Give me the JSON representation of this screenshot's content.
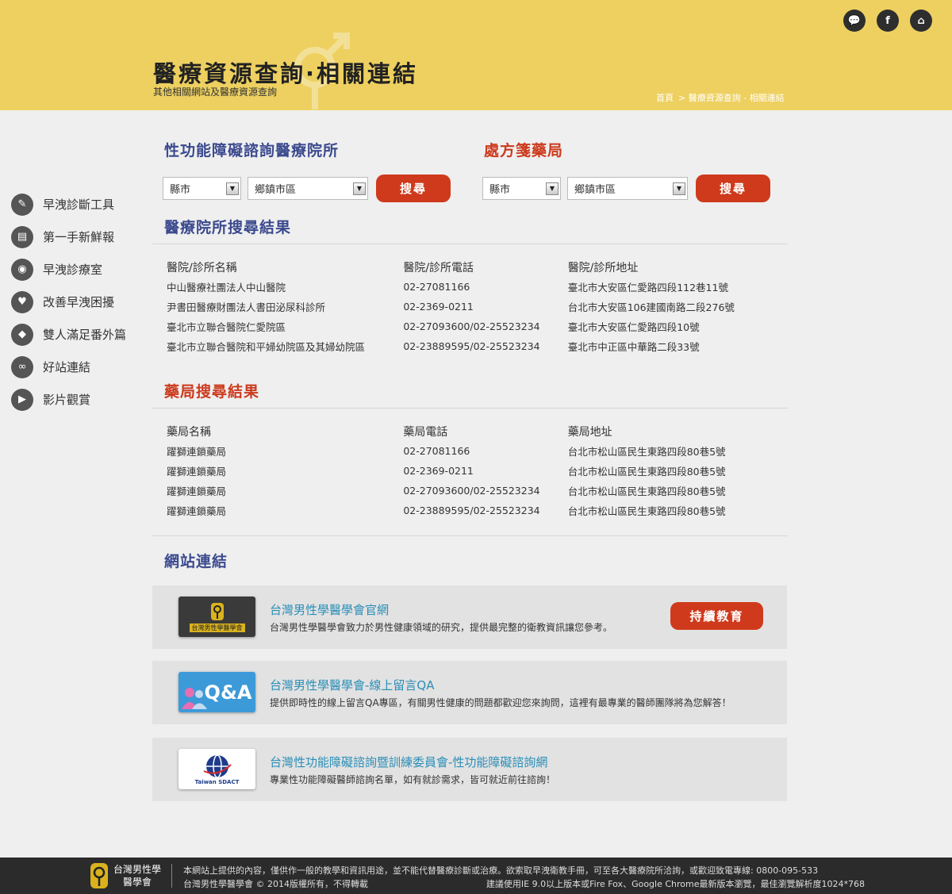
{
  "header": {
    "title": "醫療資源查詢·相關連結",
    "subtitle": "其他相關網站及醫療資源查詢",
    "breadcrumb": [
      "首頁",
      "> 醫療資源查詢 - 相關連結"
    ],
    "icons": [
      "chat-icon",
      "facebook-icon",
      "home-icon"
    ],
    "icon_glyphs": [
      "💬",
      "f",
      "⌂"
    ]
  },
  "sidebar": {
    "items": [
      {
        "label": "早洩診斷工具",
        "icon": "edit-icon",
        "glyph": "✎"
      },
      {
        "label": "第一手新鮮報",
        "icon": "news-icon",
        "glyph": "▤"
      },
      {
        "label": "早洩診療室",
        "icon": "camera-icon",
        "glyph": "◉"
      },
      {
        "label": "改善早洩困擾",
        "icon": "heart-icon",
        "glyph": "♥"
      },
      {
        "label": "雙人滿足番外篇",
        "icon": "diamond-icon",
        "glyph": "◆"
      },
      {
        "label": "好站連結",
        "icon": "link-icon",
        "glyph": "∞"
      },
      {
        "label": "影片觀賞",
        "icon": "video-icon",
        "glyph": "▶"
      }
    ]
  },
  "hospital_search": {
    "title": "性功能障礙諮詢醫療院所",
    "city_select": "縣市",
    "district_select": "鄉鎮市區",
    "button": "搜尋"
  },
  "pharmacy_search": {
    "title": "處方箋藥局",
    "city_select": "縣市",
    "district_select": "鄉鎮市區",
    "button": "搜尋"
  },
  "hospital_results": {
    "title": "醫療院所搜尋結果",
    "columns": [
      "醫院/診所名稱",
      "醫院/診所電話",
      "醫院/診所地址"
    ],
    "rows": [
      [
        "中山醫療社團法人中山醫院",
        "02-27081166",
        "臺北市大安區仁愛路四段112巷11號"
      ],
      [
        "尹書田醫療財團法人書田泌尿科診所",
        "02-2369-0211",
        "台北市大安區106建國南路二段276號"
      ],
      [
        "臺北市立聯合醫院仁愛院區",
        "02-27093600/02-25523234",
        "臺北市大安區仁愛路四段10號"
      ],
      [
        "臺北市立聯合醫院和平婦幼院區及其婦幼院區",
        "02-23889595/02-25523234",
        "臺北市中正區中華路二段33號"
      ]
    ]
  },
  "pharmacy_results": {
    "title": "藥局搜尋結果",
    "columns": [
      "藥局名稱",
      "藥局電話",
      "藥局地址"
    ],
    "rows": [
      [
        "躍獅連鎖藥局",
        "02-27081166",
        "台北市松山區民生東路四段80巷5號"
      ],
      [
        "躍獅連鎖藥局",
        "02-2369-0211",
        "台北市松山區民生東路四段80巷5號"
      ],
      [
        "躍獅連鎖藥局",
        "02-27093600/02-25523234",
        "台北市松山區民生東路四段80巷5號"
      ],
      [
        "躍獅連鎖藥局",
        "02-23889595/02-25523234",
        "台北市松山區民生東路四段80巷5號"
      ]
    ]
  },
  "web_links": {
    "title": "網站連結",
    "items": [
      {
        "title": "台灣男性學醫學會官網",
        "desc": "台灣男性學醫學會致力於男性健康領域的研究，提供最完整的衛教資訊讓您參考。",
        "logo_text": "台灣男性學醫學會",
        "button": "持續教育"
      },
      {
        "title": "台灣男性學醫學會-線上留言QA",
        "desc": "提供即時性的線上留言QA專區，有關男性健康的問題都歡迎您來詢問，這裡有最專業的醫師團隊將為您解答！",
        "logo_text": "Q&A"
      },
      {
        "title": "台灣性功能障礙諮詢暨訓練委員會-性功能障礙諮詢網",
        "desc": "專業性功能障礙醫師諮詢名單，如有就診需求，皆可就近前往諮詢！",
        "logo_text": "Taiwan SDACT"
      }
    ]
  },
  "footer": {
    "org_line1": "台灣男性學",
    "org_line2": "醫學會",
    "text1": "本網站上提供的內容，僅供作一般的教學和資訊用途，並不能代替醫療診斷或治療。欲索取早洩衛教手冊，可至各大醫療院所洽詢，或歡迎致電專線: 0800-095-533",
    "text2": "台灣男性學醫學會 © 2014版權所有，不得轉載",
    "text3": "建議使用IE 9.0以上版本或Fire Fox、Google Chrome最新版本瀏覽，最佳瀏覽解析度1024*768"
  },
  "colors": {
    "header_bg": "#edd060",
    "accent_red": "#cf3a1c",
    "title_blue": "#3b4a8e",
    "link_teal": "#2a8eb7",
    "footer_bg": "#2b2b2b"
  }
}
